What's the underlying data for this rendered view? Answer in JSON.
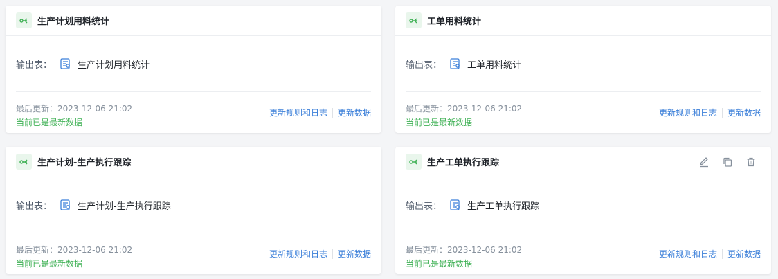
{
  "output_label": "输出表：",
  "updated_prefix": "最后更新：",
  "links": {
    "rules_logs": "更新规则和日志",
    "update_data": "更新数据"
  },
  "icons": {
    "card": "flow-icon",
    "table": "table-icon",
    "edit": "edit-icon",
    "copy": "copy-icon",
    "delete": "delete-icon"
  },
  "colors": {
    "icon_bg": "#e9f6ec",
    "icon_fg": "#3fb155",
    "link": "#3b7fd9",
    "status": "#3fb155"
  },
  "cards": [
    {
      "title": "生产计划用料统计",
      "output_table": "生产计划用料统计",
      "updated": "2023-12-06 21:02",
      "status": "当前已是最新数据"
    },
    {
      "title": "工单用料统计",
      "output_table": "工单用料统计",
      "updated": "2023-12-06 21:02",
      "status": "当前已是最新数据"
    },
    {
      "title": "生产计划-生产执行跟踪",
      "output_table": "生产计划-生产执行跟踪",
      "updated": "2023-12-06 21:02",
      "status": "当前已是最新数据"
    },
    {
      "title": "生产工单执行跟踪",
      "output_table": "生产工单执行跟踪",
      "updated": "2023-12-06 21:02",
      "status": "当前已是最新数据",
      "hovered": true
    }
  ]
}
